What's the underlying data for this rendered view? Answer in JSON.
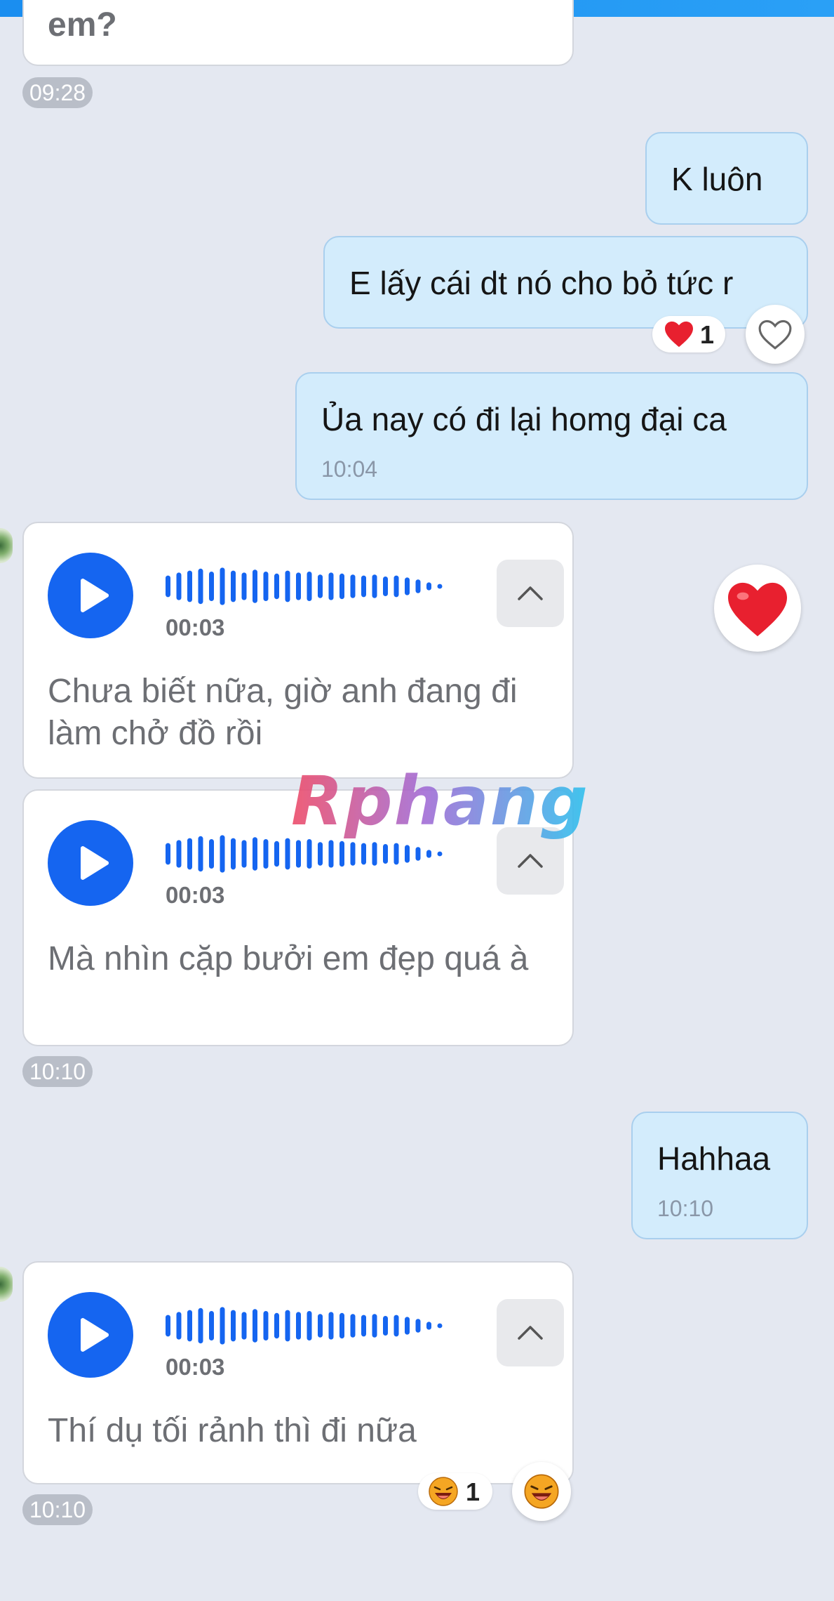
{
  "chat": {
    "partial_message": {
      "text": "em?"
    },
    "time_pill_1": "09:28",
    "out_1": {
      "text": "K luôn"
    },
    "out_2": {
      "text": "E lấy cái dt nó cho bỏ tức r",
      "reaction_count": "1"
    },
    "out_3": {
      "text": "Ủa nay có đi lại homg đại ca",
      "time": "10:04"
    },
    "voice_1": {
      "duration": "00:03",
      "transcript": "Chưa biết nữa, giờ anh đang đi làm chở đồ rồi"
    },
    "voice_2": {
      "duration": "00:03",
      "transcript": "Mà nhìn cặp bưởi em đẹp quá à"
    },
    "time_pill_2": "10:10",
    "out_4": {
      "text": "Hahhaa",
      "time": "10:10"
    },
    "voice_3": {
      "duration": "00:03",
      "transcript": "Thí dụ tối rảnh thì đi nữa",
      "reaction_count": "1"
    },
    "time_pill_3": "10:10"
  },
  "watermark": "Rphang",
  "colors": {
    "background": "#e4e8f1",
    "outgoing_bubble": "#d3ecfc",
    "incoming_bubble": "#ffffff",
    "accent_blue": "#1565f0",
    "heart_red": "#e8202f"
  },
  "icons": [
    "play-icon",
    "voice-waveform",
    "chevron-up-icon",
    "heart-icon",
    "heart-outline-icon",
    "laughing-emoji-icon"
  ]
}
